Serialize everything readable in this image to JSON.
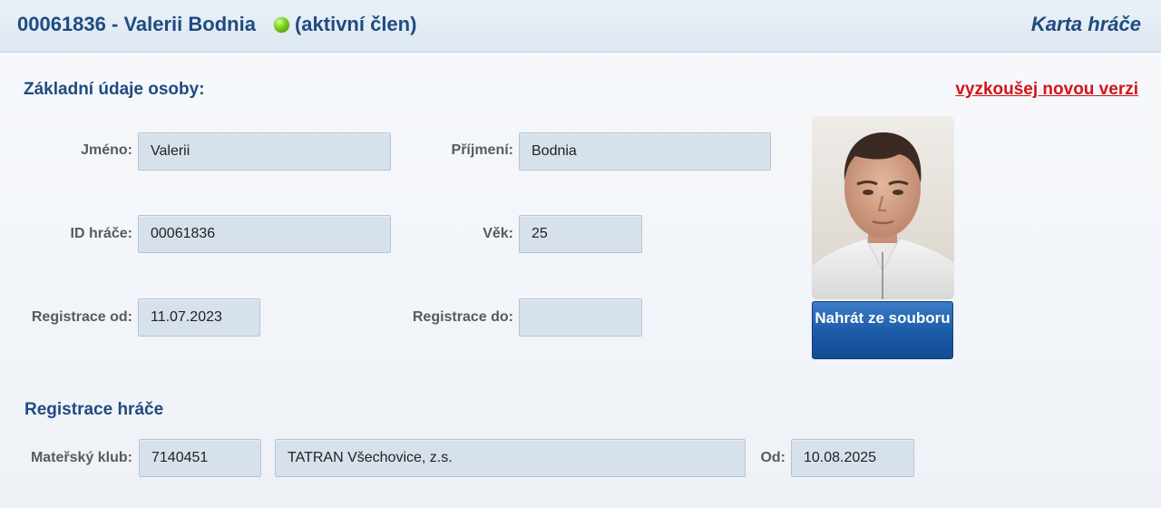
{
  "header": {
    "player_id": "00061836",
    "separator": " - ",
    "player_name": "Valerii Bodnia",
    "status": "(aktivní člen)",
    "status_color": "#5bbd14",
    "card_title": "Karta hráče"
  },
  "basic": {
    "title": "Základní údaje osoby:",
    "new_version_link": "vyzkoušej novou verzi",
    "fields": {
      "first_name": {
        "label": "Jméno:",
        "value": "Valerii"
      },
      "last_name": {
        "label": "Příjmení:",
        "value": "Bodnia"
      },
      "player_id": {
        "label": "ID hráče:",
        "value": "00061836"
      },
      "age": {
        "label": "Věk:",
        "value": "25"
      },
      "reg_from": {
        "label": "Registrace od:",
        "value": "11.07.2023"
      },
      "reg_to": {
        "label": "Registrace do:",
        "value": ""
      }
    },
    "upload_button": "Nahrát ze souboru"
  },
  "registration": {
    "title": "Registrace hráče",
    "club_label": "Mateřský klub:",
    "club_id": "7140451",
    "club_name": "TATRAN Všechovice, z.s.",
    "since_label": "Od:",
    "since_date": "10.08.2025"
  },
  "colors": {
    "heading": "#1f4b80",
    "link": "#d3141a",
    "field_bg": "#d6e1ec",
    "button": "#1b5aa6"
  }
}
